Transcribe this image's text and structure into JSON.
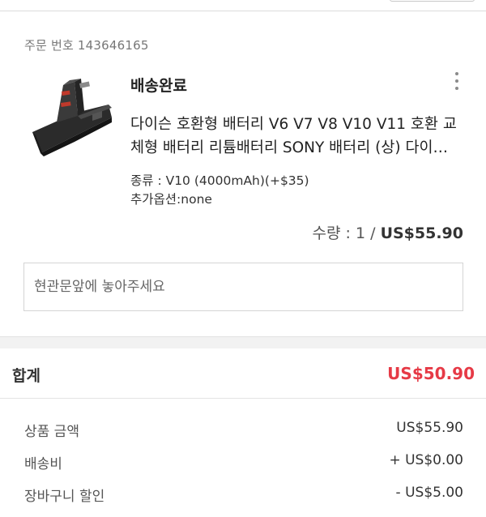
{
  "order": {
    "number_text": "주문 번호 143646165",
    "status": "배송완료",
    "product_title": "다이슨 호환형 배터리 V6 V7 V8 V10 V11 호환 교체형 배터리 리튬배터리 SONY 배터리 (상) 다이슨 무선청소기 배터리",
    "option_type": "종류 : V10 (4000mAh)(+$35)",
    "option_extra": "추가옵션:none",
    "quantity_text": "수량 : 1 / ",
    "price": "US$55.90",
    "note_placeholder": "현관문앞에 놓아주세요",
    "thumbnail_icon": "battery-product-image",
    "more_icon": "more-vertical-icon"
  },
  "summary": {
    "total_label": "합계",
    "total_value": "US$50.90",
    "total_color": "#e63a46",
    "rows": [
      {
        "label": "상품 금액",
        "value": "US$55.90"
      },
      {
        "label": "배송비",
        "value": "+ US$0.00"
      },
      {
        "label": "장바구니 할인",
        "value": "- US$5.00"
      }
    ]
  }
}
